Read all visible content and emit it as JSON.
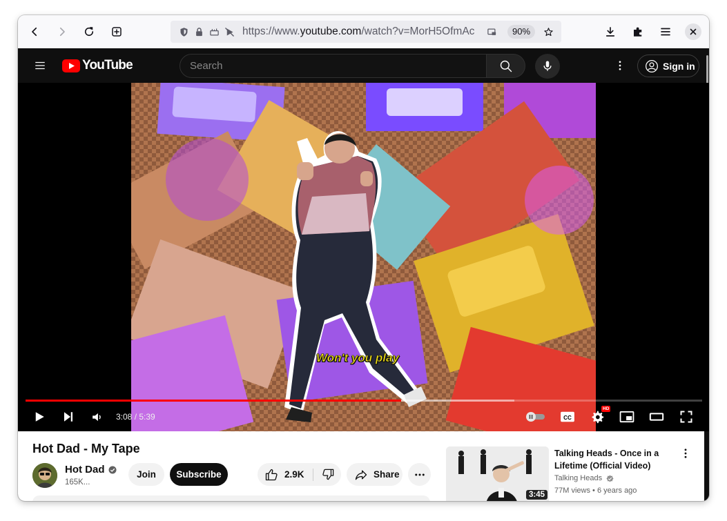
{
  "browser": {
    "url_prefix": "https://www.",
    "url_host": "youtube.com",
    "url_rest": "/watch?v=MorH5OfmAc",
    "zoom": "90%"
  },
  "youtube": {
    "logo_text": "YouTube",
    "search_placeholder": "Search",
    "signin_label": "Sign in",
    "colors": {
      "brand": "#ff0000",
      "dark_bg": "#0f0f0f"
    }
  },
  "player": {
    "caption": "Won't you play",
    "current_time": "3:08",
    "time_separator": " / ",
    "duration": "5:39",
    "progress_played": 0.555,
    "progress_buffered": 0.722,
    "hd_badge": "HD",
    "cc_label": "CC"
  },
  "video": {
    "title": "Hot Dad - My Tape",
    "channel": "Hot Dad",
    "subscribers": "165K...",
    "join_label": "Join",
    "subscribe_label": "Subscribe",
    "likes": "2.9K",
    "share_label": "Share"
  },
  "recommendation": {
    "title": "Talking Heads - Once in a Lifetime (Official Video)",
    "channel": "Talking Heads",
    "views": "77M views",
    "age": "6 years ago",
    "meta_separator": " • ",
    "duration": "3:45"
  }
}
